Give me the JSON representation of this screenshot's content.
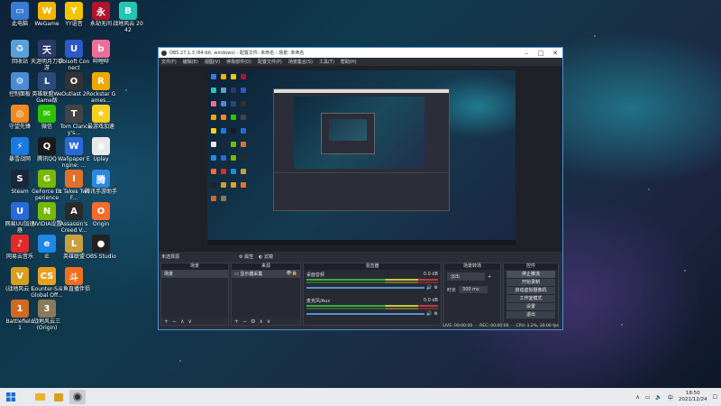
{
  "desktop_icons": [
    {
      "label": "此电脑",
      "color": "#3a7bd5",
      "glyph": "▭"
    },
    {
      "label": "WeGame",
      "color": "#f2b400",
      "glyph": "W"
    },
    {
      "label": "YY语音",
      "color": "#f5c400",
      "glyph": "Y"
    },
    {
      "label": "永劫无间",
      "color": "#b2142a",
      "glyph": "永"
    },
    {
      "label": "战地风云 2042",
      "color": "#1ec8b4",
      "glyph": "B"
    },
    {
      "label": "回收站",
      "color": "#5aa0d8",
      "glyph": "♻"
    },
    {
      "label": "天涯明月刀手游",
      "color": "#2a3a6a",
      "glyph": "天"
    },
    {
      "label": "Ubisoft Connect",
      "color": "#2d58c8",
      "glyph": "U"
    },
    {
      "label": "哔哩哔",
      "color": "#ee6e9a",
      "glyph": "b"
    },
    {
      "label": "控制面板",
      "color": "#4b8ad6",
      "glyph": "⚙"
    },
    {
      "label": "英雄联盟WeGame版",
      "color": "#2a4a7a",
      "glyph": "L"
    },
    {
      "label": "Outlast 2",
      "color": "#333",
      "glyph": "O"
    },
    {
      "label": "Rockstar Games...",
      "color": "#f0a800",
      "glyph": "R"
    },
    {
      "label": "守望先锋",
      "color": "#f08a20",
      "glyph": "◎"
    },
    {
      "label": "微信",
      "color": "#2dc100",
      "glyph": "✉"
    },
    {
      "label": "Tom Clancy's...",
      "color": "#444",
      "glyph": "T"
    },
    {
      "label": "最游戏加速",
      "color": "#f5d020",
      "glyph": "★"
    },
    {
      "label": "暴雪战网",
      "color": "#1a7ae0",
      "glyph": "⚡"
    },
    {
      "label": "腾讯QQ",
      "color": "#1a1a1a",
      "glyph": "Q"
    },
    {
      "label": "Wallpaper Engine: ...",
      "color": "#2a6ad8",
      "glyph": "W"
    },
    {
      "label": "Uplay",
      "color": "#e8e8e8",
      "glyph": "◉"
    },
    {
      "label": "Steam",
      "color": "#1b2838",
      "glyph": "S"
    },
    {
      "label": "GeForce Experience",
      "color": "#76b900",
      "glyph": "G"
    },
    {
      "label": "It Takes Two F...",
      "color": "#e0702a",
      "glyph": "I"
    },
    {
      "label": "腾讯手游助手",
      "color": "#2a8ae0",
      "glyph": "腾"
    },
    {
      "label": "网易UU加速器",
      "color": "#2a6ad8",
      "glyph": "U"
    },
    {
      "label": "NVIDIA设置",
      "color": "#76b900",
      "glyph": "N"
    },
    {
      "label": "Assassin's Creed V...",
      "color": "#2a2a2a",
      "glyph": "A"
    },
    {
      "label": "Origin",
      "color": "#f56c2d",
      "glyph": "O"
    },
    {
      "label": "网易云音乐",
      "color": "#e12a2a",
      "glyph": "♪"
    },
    {
      "label": "IE",
      "color": "#1e88e5",
      "glyph": "e"
    },
    {
      "label": "英雄联盟",
      "color": "#c8a040",
      "glyph": "L"
    },
    {
      "label": "OBS Studio",
      "color": "#222",
      "glyph": "●"
    },
    {
      "label": "(战地风云 5",
      "color": "#d8a020",
      "glyph": "V"
    },
    {
      "label": "Counter-S... Global Off...",
      "color": "#e8a020",
      "glyph": "CS"
    },
    {
      "label": "斗鱼直播伴侣",
      "color": "#f07020",
      "glyph": "斗"
    },
    {
      "label": "Battlefield 1",
      "color": "#d06a20",
      "glyph": "1"
    },
    {
      "label": "战地风云三(Origin)",
      "color": "#8a7a5a",
      "glyph": "3"
    }
  ],
  "obs": {
    "title": "OBS 27.1.3 (64-bit, windows) - 配置文件: 未命名 - 场景: 未命名",
    "menu": [
      "文件(F)",
      "编辑(E)",
      "视图(V)",
      "停靠部件(D)",
      "配置文件(P)",
      "场景集合(S)",
      "工具(T)",
      "帮助(H)"
    ],
    "selection_bar": [
      "未选择源",
      "属性",
      "滤镜"
    ],
    "scenes": {
      "header": "场景",
      "items": [
        "场景"
      ]
    },
    "sources": {
      "header": "来源",
      "items": [
        "显示器采集"
      ]
    },
    "mixer": {
      "header": "混音器",
      "channels": [
        {
          "name": "桌面音频",
          "db": "0.0 dB"
        },
        {
          "name": "麦克风/Aux",
          "db": "0.0 dB"
        }
      ]
    },
    "transitions": {
      "header": "场景转场",
      "type": "淡出",
      "duration_label": "时长",
      "duration": "300 ms"
    },
    "controls": {
      "header": "控件",
      "buttons": [
        "停止推流",
        "开始录制",
        "启动虚拟摄像机",
        "工作室模式",
        "设置",
        "退出"
      ]
    },
    "status": {
      "live": "LIVE: 00:00:00",
      "rec": "REC: 00:00:00",
      "cpu": "CPU: 1.2%, 30.00 fps"
    }
  },
  "taskbar": {
    "time": "18:50",
    "date": "2021/12/24"
  }
}
